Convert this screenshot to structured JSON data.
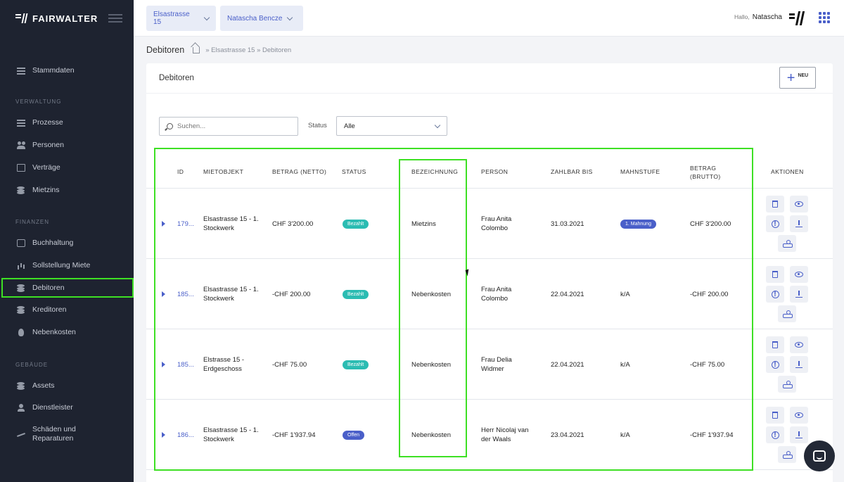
{
  "brand": {
    "name": "FAIRWALTER"
  },
  "sidebar": {
    "top_item": "Stammdaten",
    "sections": [
      {
        "label": "VERWALTUNG",
        "items": [
          "Prozesse",
          "Personen",
          "Verträge",
          "Mietzins"
        ]
      },
      {
        "label": "FINANZEN",
        "items": [
          "Buchhaltung",
          "Sollstellung Miete",
          "Debitoren",
          "Kreditoren",
          "Nebenkosten"
        ]
      },
      {
        "label": "GEBÄUDE",
        "items": [
          "Assets",
          "Dienstleister",
          "Schäden und Reparaturen"
        ]
      }
    ],
    "active": "Debitoren"
  },
  "topbar": {
    "property_selector": "Elsastrasse 15",
    "user_selector": "Natascha Bencze",
    "greeting_prefix": "Hallo,",
    "greeting_name": "Natascha"
  },
  "breadcrumb": {
    "title": "Debitoren",
    "trail": "» Elsastrasse 15 » Debitoren"
  },
  "card": {
    "title": "Debitoren",
    "new_button": "NEU",
    "search_placeholder": "Suchen...",
    "status_label": "Status",
    "status_value": "Alle"
  },
  "table": {
    "headers": {
      "id": "ID",
      "mietobjekt": "MIETOBJEKT",
      "betrag_netto": "BETRAG (NETTO)",
      "status": "STATUS",
      "bezeichnung": "BEZEICHNUNG",
      "person": "PERSON",
      "zahlbar_bis": "ZAHLBAR BIS",
      "mahnstufe": "MAHNSTUFE",
      "betrag_brutto": "BETRAG (BRUTTO)",
      "aktionen": "AKTIONEN"
    },
    "rows": [
      {
        "id": "179...",
        "mietobjekt": "Elsastrasse 15 - 1. Stockwerk",
        "betrag_netto": "CHF 3'200.00",
        "status": "Bezahlt",
        "status_color": "#2bbcb2",
        "bezeichnung": "Mietzins",
        "person": "Frau Anita Colombo",
        "zahlbar_bis": "31.03.2021",
        "mahnstufe": "1. Mahnung",
        "mahnstufe_badge": true,
        "betrag_brutto": "CHF 3'200.00"
      },
      {
        "id": "185...",
        "mietobjekt": "Elsastrasse 15 - 1. Stockwerk",
        "betrag_netto": "-CHF 200.00",
        "status": "Bezahlt",
        "status_color": "#2bbcb2",
        "bezeichnung": "Nebenkosten",
        "person": "Frau Anita Colombo",
        "zahlbar_bis": "22.04.2021",
        "mahnstufe": "k/A",
        "mahnstufe_badge": false,
        "betrag_brutto": "-CHF 200.00"
      },
      {
        "id": "185...",
        "mietobjekt": "Elstrasse 15 - Erdgeschoss",
        "betrag_netto": "-CHF 75.00",
        "status": "Bezahlt",
        "status_color": "#2bbcb2",
        "bezeichnung": "Nebenkosten",
        "person": "Frau Delia Widmer",
        "zahlbar_bis": "22.04.2021",
        "mahnstufe": "k/A",
        "mahnstufe_badge": false,
        "betrag_brutto": "-CHF 75.00"
      },
      {
        "id": "186...",
        "mietobjekt": "Elsastrasse 15 - 1. Stockwerk",
        "betrag_netto": "-CHF 1'937.94",
        "status": "Offen",
        "status_color": "#4a5fc9",
        "bezeichnung": "Nebenkosten",
        "person": "Herr Nicolaj van der Waals",
        "zahlbar_bis": "23.04.2021",
        "mahnstufe": "k/A",
        "mahnstufe_badge": false,
        "betrag_brutto": "-CHF 1'937.94"
      }
    ]
  }
}
